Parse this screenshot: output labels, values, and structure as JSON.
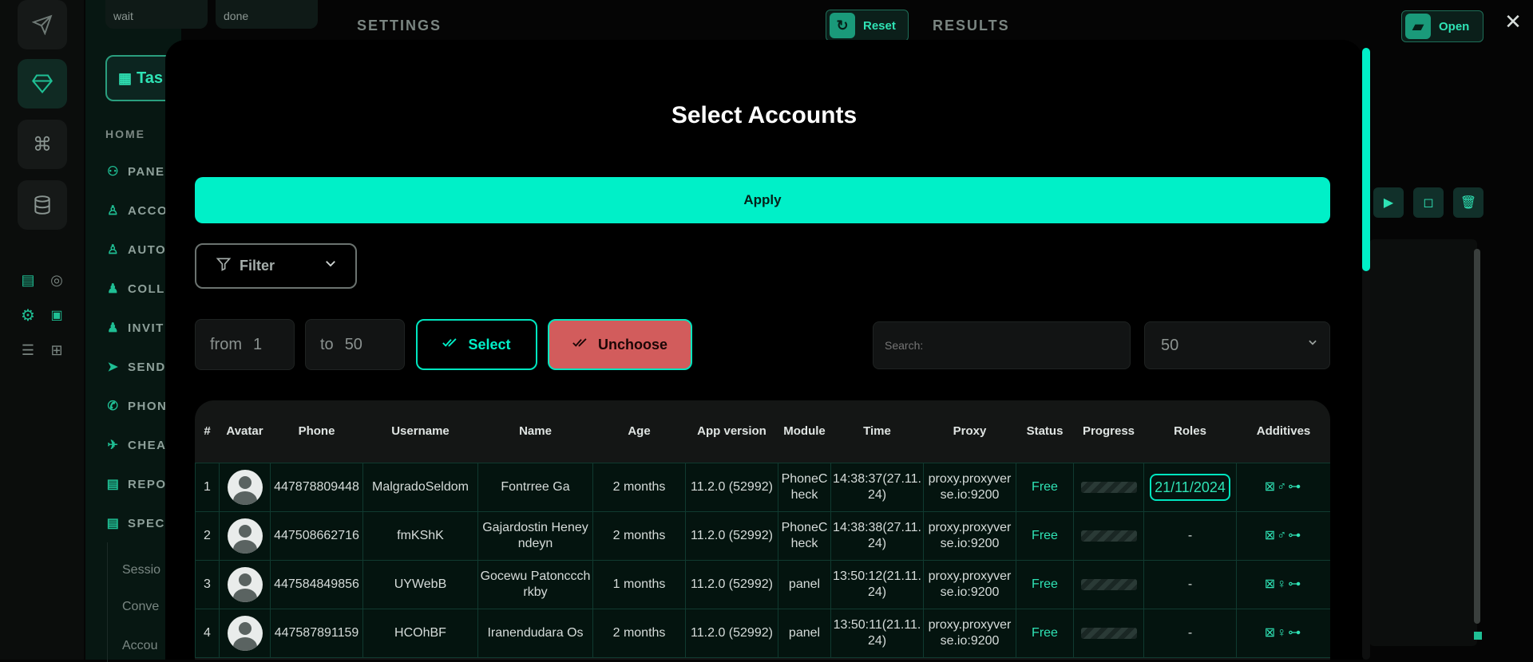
{
  "top_pills": {
    "left": "wait",
    "right": "done"
  },
  "sidebar": {
    "tasks_label": "Tas",
    "home_heading": "HOME",
    "items": [
      {
        "label": "PANEI",
        "icon": "users-icon"
      },
      {
        "label": "ACCO",
        "icon": "user-icon"
      },
      {
        "label": "AUTO",
        "icon": "user-plus-icon"
      },
      {
        "label": "COLL",
        "icon": "users-collect-icon"
      },
      {
        "label": "INVIT",
        "icon": "user-invite-icon"
      },
      {
        "label": "SEND",
        "icon": "send-icon"
      },
      {
        "label": "PHON",
        "icon": "phone-icon"
      },
      {
        "label": "CHEA",
        "icon": "rocket-icon"
      },
      {
        "label": "REPO",
        "icon": "report-icon"
      },
      {
        "label": "SPECI",
        "icon": "special-icon"
      }
    ],
    "sub_items": [
      "Sessio",
      "Conve",
      "Accou"
    ]
  },
  "topbar": {
    "settings": "SETTINGS",
    "reset": "Reset",
    "results": "RESULTS",
    "open": "Open"
  },
  "modal": {
    "title": "Select Accounts",
    "apply": "Apply",
    "filter": "Filter",
    "from_label": "from",
    "from_value": "1",
    "to_label": "to",
    "to_value": "50",
    "select": "Select",
    "unchoose": "Unchoose",
    "search_placeholder": "Search:",
    "per_page": "50"
  },
  "table": {
    "headers": [
      "#",
      "Avatar",
      "Phone",
      "Username",
      "Name",
      "Age",
      "App version",
      "Module",
      "Time",
      "Proxy",
      "Status",
      "Progress",
      "Roles",
      "Additives"
    ],
    "rows": [
      {
        "num": "1",
        "phone": "447878809448",
        "username": "MalgradoSeldom",
        "name": "Fontrree Ga",
        "age": "2 months",
        "app_version": "11.2.0 (52992)",
        "module": "PhoneCheck",
        "time": "14:38:37(27.11.24)",
        "proxy": "proxy.proxyverse.io:9200",
        "status": "Free",
        "roles": "21/11/2024",
        "additives": "⊠♂⊶"
      },
      {
        "num": "2",
        "phone": "447508662716",
        "username": "fmKShK",
        "name": "Gajardostin Heneyndeyn",
        "age": "2 months",
        "app_version": "11.2.0 (52992)",
        "module": "PhoneCheck",
        "time": "14:38:38(27.11.24)",
        "proxy": "proxy.proxyverse.io:9200",
        "status": "Free",
        "roles": "-",
        "additives": "⊠♂⊶"
      },
      {
        "num": "3",
        "phone": "447584849856",
        "username": "UYWebB",
        "name": "Gocewu Patonccchrkby",
        "age": "1 months",
        "app_version": "11.2.0 (52992)",
        "module": "panel",
        "time": "13:50:12(21.11.24)",
        "proxy": "proxy.proxyverse.io:9200",
        "status": "Free",
        "roles": "-",
        "additives": "⊠♀⊶"
      },
      {
        "num": "4",
        "phone": "447587891159",
        "username": "HCOhBF",
        "name": "Iranendudara Os",
        "age": "2 months",
        "app_version": "11.2.0 (52992)",
        "module": "panel",
        "time": "13:50:11(21.11.24)",
        "proxy": "proxy.proxyverse.io:9200",
        "status": "Free",
        "roles": "-",
        "additives": "⊠♀⊶"
      }
    ]
  },
  "colors": {
    "accent": "#00f0c8",
    "danger": "#d25c5c",
    "background": "#000000"
  }
}
